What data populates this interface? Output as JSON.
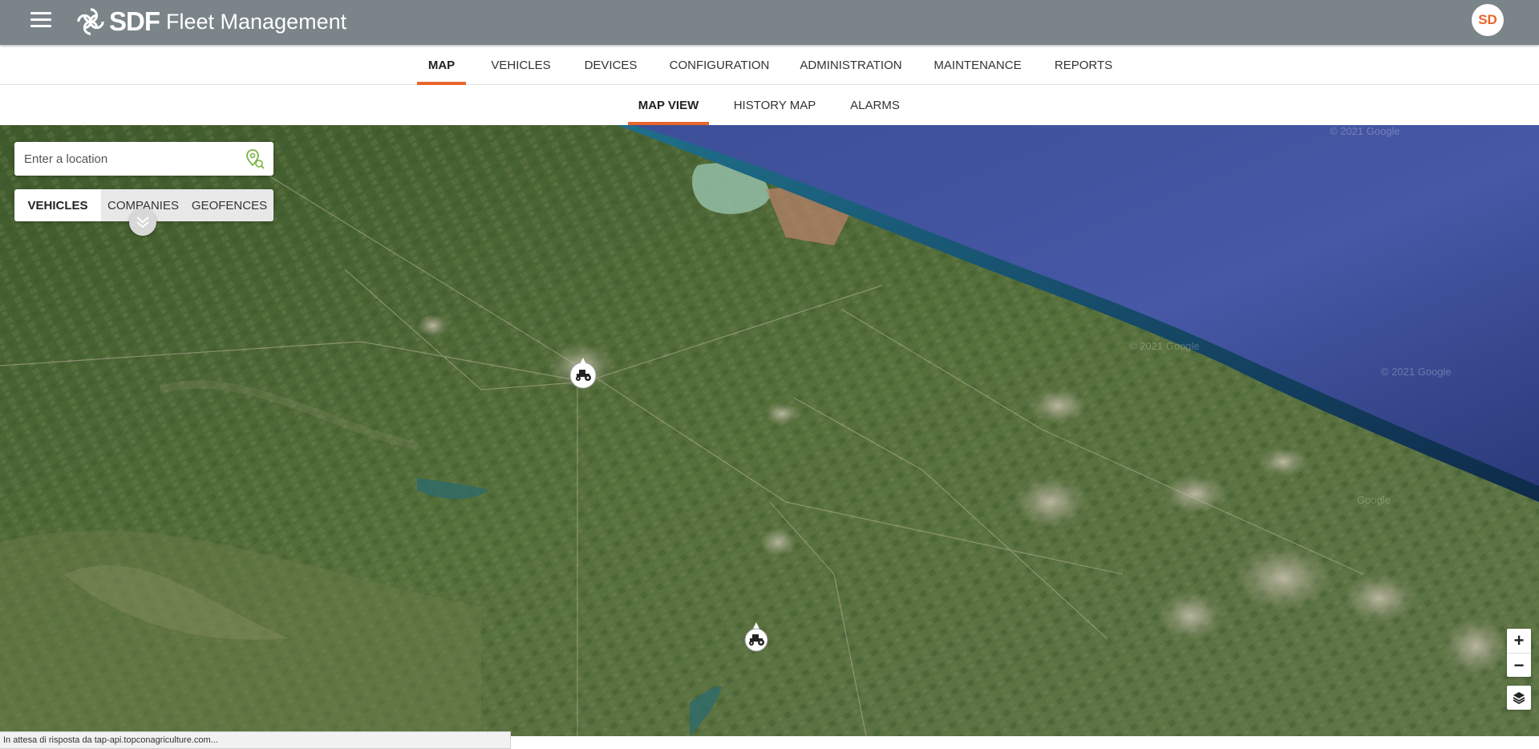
{
  "app": {
    "logo_brand": "SDF",
    "logo_text": "Fleet Management",
    "user_initials": "SD",
    "accent_color": "#e8652b",
    "header_color": "#7a8489"
  },
  "main_nav": [
    {
      "label": "MAP",
      "active": true
    },
    {
      "label": "VEHICLES",
      "active": false
    },
    {
      "label": "DEVICES",
      "active": false
    },
    {
      "label": "CONFIGURATION",
      "active": false
    },
    {
      "label": "ADMINISTRATION",
      "active": false
    },
    {
      "label": "MAINTENANCE",
      "active": false
    },
    {
      "label": "REPORTS",
      "active": false
    }
  ],
  "sub_nav": [
    {
      "label": "MAP VIEW",
      "active": true
    },
    {
      "label": "HISTORY MAP",
      "active": false
    },
    {
      "label": "ALARMS",
      "active": false
    }
  ],
  "map": {
    "search_placeholder": "Enter a location",
    "segments": [
      {
        "label": "VEHICLES",
        "active": true
      },
      {
        "label": "COMPANIES",
        "active": false
      },
      {
        "label": "GEOFENCES",
        "active": false
      }
    ],
    "copyright": "© 2021 Google",
    "copyright_short": "Google",
    "zoom_in": "+",
    "zoom_out": "−",
    "vehicle_markers": [
      {
        "icon": "tractor-icon"
      },
      {
        "icon": "tractor-icon"
      }
    ]
  },
  "status_bar": {
    "text": "In attesa di risposta da tap-api.topconagriculture.com..."
  }
}
